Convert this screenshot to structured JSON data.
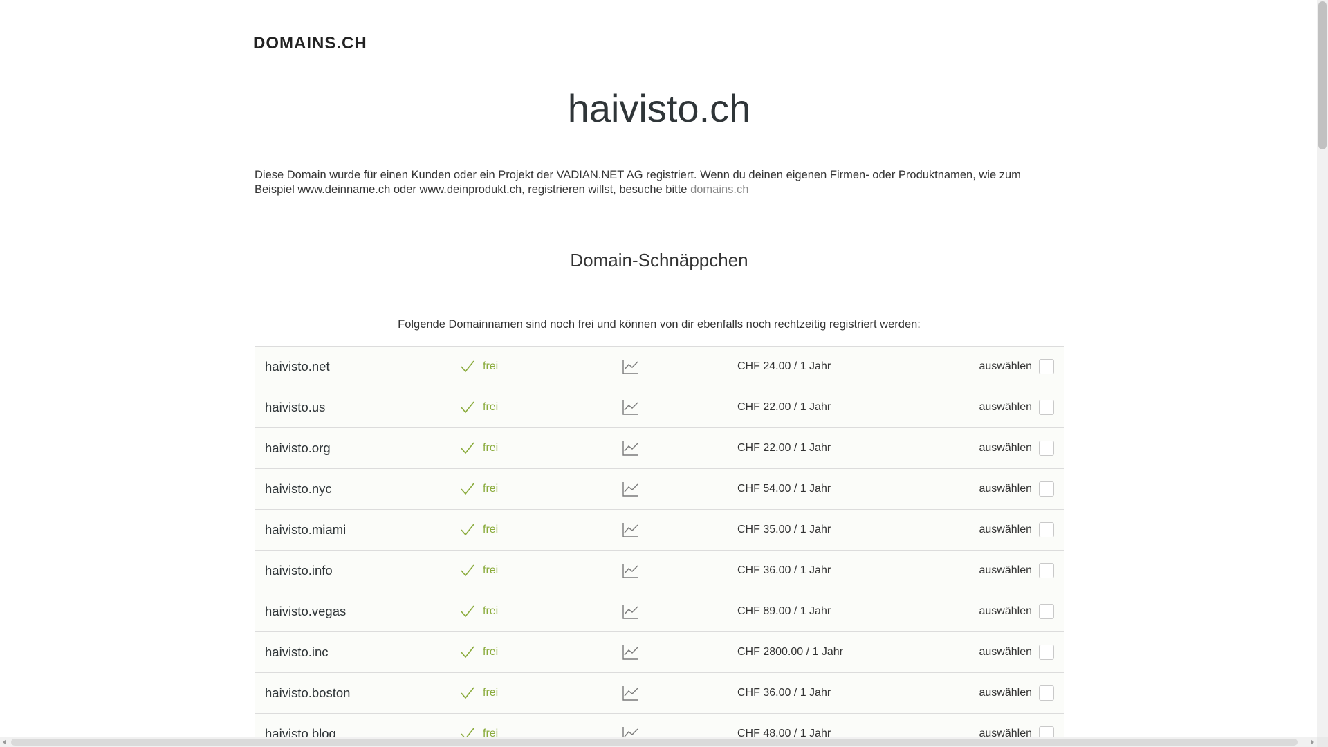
{
  "logo": "DOMAINS.CH",
  "domain_title": "haivisto.ch",
  "intro": {
    "text": "Diese Domain wurde für einen Kunden oder ein Projekt der VADIAN.NET AG registriert. Wenn du deinen eigenen Firmen- oder Produktnamen, wie zum Beispiel www.deinname.ch oder www.deinprodukt.ch, registrieren willst, besuche bitte ",
    "link_label": "domains.ch"
  },
  "section_title": "Domain-Schnäppchen",
  "lead": "Folgende Domainnamen sind noch frei und können von dir ebenfalls noch rechtzeitig registriert werden:",
  "colors": {
    "status_green": "#8aab3c",
    "row_background": "#fbfcf9",
    "divider": "#dcdcdc"
  },
  "icons": {
    "status": "checkmark-icon",
    "trend": "trend-chart-icon",
    "select": "checkbox"
  },
  "domains": [
    {
      "name": "haivisto.net",
      "status": "frei",
      "price": "CHF 24.00 / 1 Jahr",
      "select_label": "auswählen"
    },
    {
      "name": "haivisto.us",
      "status": "frei",
      "price": "CHF 22.00 / 1 Jahr",
      "select_label": "auswählen"
    },
    {
      "name": "haivisto.org",
      "status": "frei",
      "price": "CHF 22.00 / 1 Jahr",
      "select_label": "auswählen"
    },
    {
      "name": "haivisto.nyc",
      "status": "frei",
      "price": "CHF 54.00 / 1 Jahr",
      "select_label": "auswählen"
    },
    {
      "name": "haivisto.miami",
      "status": "frei",
      "price": "CHF 35.00 / 1 Jahr",
      "select_label": "auswählen"
    },
    {
      "name": "haivisto.info",
      "status": "frei",
      "price": "CHF 36.00 / 1 Jahr",
      "select_label": "auswählen"
    },
    {
      "name": "haivisto.vegas",
      "status": "frei",
      "price": "CHF 89.00 / 1 Jahr",
      "select_label": "auswählen"
    },
    {
      "name": "haivisto.inc",
      "status": "frei",
      "price": "CHF 2800.00 / 1 Jahr",
      "select_label": "auswählen"
    },
    {
      "name": "haivisto.boston",
      "status": "frei",
      "price": "CHF 36.00 / 1 Jahr",
      "select_label": "auswählen"
    },
    {
      "name": "haivisto.blog",
      "status": "frei",
      "price": "CHF 48.00 / 1 Jahr",
      "select_label": "auswählen"
    }
  ]
}
